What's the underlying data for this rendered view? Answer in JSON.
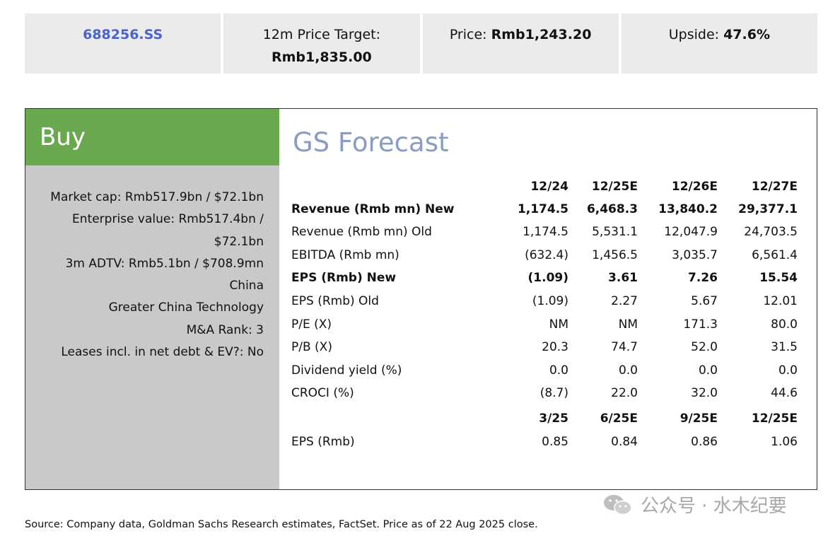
{
  "header": {
    "ticker": "688256.SS",
    "target_label": "12m Price Target:",
    "target_value": "Rmb1,835.00",
    "price_label": "Price:",
    "price_value": "Rmb1,243.20",
    "upside_label": "Upside:",
    "upside_value": "47.6%"
  },
  "rating": "Buy",
  "facts": [
    "Market cap: Rmb517.9bn / $72.1bn",
    "Enterprise value: Rmb517.4bn /",
    "$72.1bn",
    "3m ADTV: Rmb5.1bn / $708.9mn",
    "China",
    "Greater China Technology",
    "M&A Rank: 3",
    "Leases incl. in net debt & EV?: No"
  ],
  "forecast": {
    "title": "GS Forecast",
    "periods": [
      "12/24",
      "12/25E",
      "12/26E",
      "12/27E"
    ],
    "rows": [
      {
        "label": "Revenue (Rmb mn) New",
        "values": [
          "1,174.5",
          "6,468.3",
          "13,840.2",
          "29,377.1"
        ]
      },
      {
        "label": "Revenue (Rmb mn) Old",
        "values": [
          "1,174.5",
          "5,531.1",
          "12,047.9",
          "24,703.5"
        ]
      },
      {
        "label": "EBITDA (Rmb mn)",
        "values": [
          "(632.4)",
          "1,456.5",
          "3,035.7",
          "6,561.4"
        ]
      },
      {
        "label": "EPS (Rmb) New",
        "values": [
          "(1.09)",
          "3.61",
          "7.26",
          "15.54"
        ]
      },
      {
        "label": "EPS (Rmb) Old",
        "values": [
          "(1.09)",
          "2.27",
          "5.67",
          "12.01"
        ]
      },
      {
        "label": "P/E (X)",
        "values": [
          "NM",
          "NM",
          "171.3",
          "80.0"
        ]
      },
      {
        "label": "P/B (X)",
        "values": [
          "20.3",
          "74.7",
          "52.0",
          "31.5"
        ]
      },
      {
        "label": "Dividend yield (%)",
        "values": [
          "0.0",
          "0.0",
          "0.0",
          "0.0"
        ]
      },
      {
        "label": "CROCI (%)",
        "values": [
          "(8.7)",
          "22.0",
          "32.0",
          "44.6"
        ]
      }
    ],
    "quarter_periods": [
      "3/25",
      "6/25E",
      "9/25E",
      "12/25E"
    ],
    "quarter_row": {
      "label": "EPS (Rmb)",
      "values": [
        "0.85",
        "0.84",
        "0.86",
        "1.06"
      ]
    }
  },
  "source": "Source: Company data, Goldman Sachs Research estimates, FactSet. Price as of 22 Aug 2025 close.",
  "watermark": "公众号 · 水木纪要",
  "colors": {
    "buy": "#6aa84f",
    "ticker": "#4a63c8",
    "title": "#8a9cc4",
    "left_panel": "#c9c9c9",
    "top_box": "#ebebeb"
  }
}
